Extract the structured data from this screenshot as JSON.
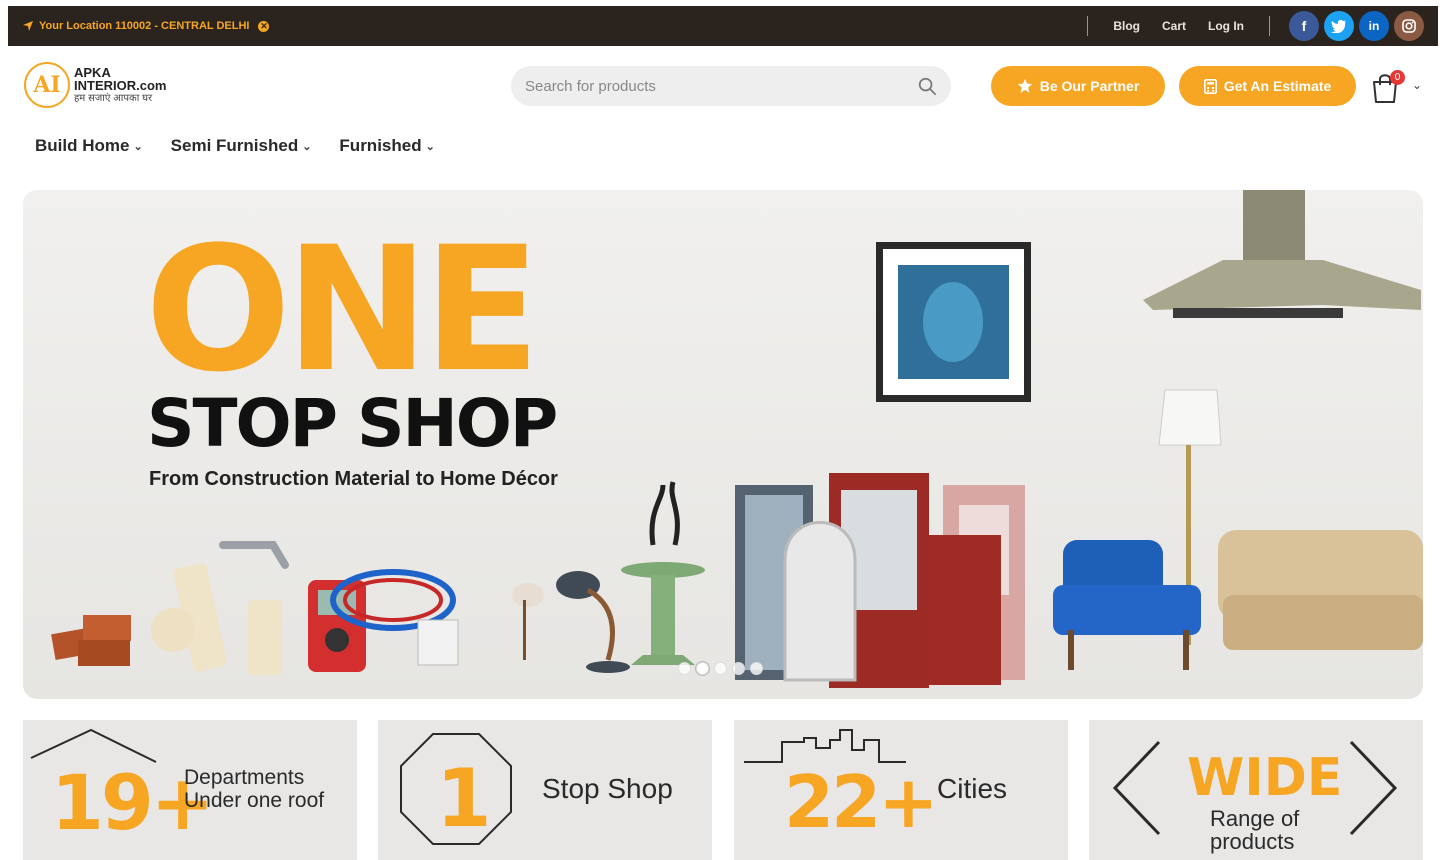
{
  "topbar": {
    "location": "Your Location 110002 - CENTRAL DELHI",
    "links": [
      "Blog",
      "Cart",
      "Log In"
    ],
    "social": [
      "f",
      "t",
      "in",
      "ig"
    ]
  },
  "logo": {
    "mark": "AI",
    "line1": "APKA",
    "line2": "INTERIOR.com",
    "tagline": "हम सजाएं आपका घर"
  },
  "search": {
    "placeholder": "Search for products"
  },
  "buttons": {
    "partner": "Be Our Partner",
    "estimate": "Get An Estimate"
  },
  "cart": {
    "count": "0"
  },
  "nav": [
    "Build Home",
    "Semi Furnished",
    "Furnished"
  ],
  "hero": {
    "title_big": "ONE",
    "title": "STOP SHOP",
    "subtitle": "From Construction Material to Home Décor",
    "slide_index": 2,
    "slide_count": 5
  },
  "stats": [
    {
      "number": "19+",
      "label_line1": "Departments",
      "label_line2": "Under one roof"
    },
    {
      "number": "1",
      "label": "Stop Shop"
    },
    {
      "number": "22+",
      "label": "Cities"
    },
    {
      "number": "WIDE",
      "label_line1": "Range of",
      "label_line2": "products"
    }
  ],
  "colors": {
    "accent": "#f6a623",
    "topbar_bg": "#2b241e"
  }
}
